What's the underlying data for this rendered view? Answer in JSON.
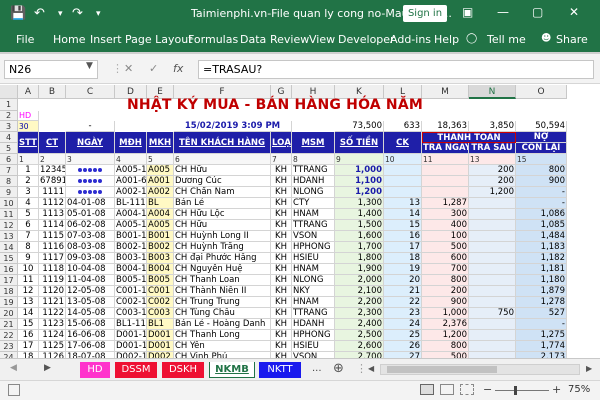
{
  "window": {
    "title": "Taimienphi.vn-File quan ly cong no-Mau01.xls...",
    "signin": "Sign in",
    "save_icon": "floppy-icon",
    "undo": "↶",
    "redo": "↷",
    "qat_more": "▾",
    "ribbon_opts": "▣",
    "minimize": "—",
    "restore": "▢",
    "close": "✕"
  },
  "menu": {
    "items": [
      "File",
      "Home",
      "Insert",
      "Page Layout",
      "Formulas",
      "Data",
      "Review",
      "View",
      "Developer",
      "Add-ins",
      "Help"
    ],
    "tellme": "Tell me",
    "share": "Share",
    "tellme_icon": "lightbulb-icon",
    "share_icon": "person-icon"
  },
  "formula": {
    "namebox": "N26",
    "cancel": "✕",
    "enter": "✓",
    "fx": "fx",
    "value": "=TRASAU?"
  },
  "columns": [
    "A",
    "B",
    "C",
    "D",
    "E",
    "F",
    "G",
    "H",
    "K",
    "L",
    "M",
    "N",
    "O"
  ],
  "row_numbers": [
    "1",
    "2",
    "3",
    "4",
    "5",
    "6",
    "7",
    "8",
    "9",
    "10",
    "11",
    "12",
    "13",
    "14",
    "15",
    "16",
    "17",
    "18",
    "19",
    "20",
    "21",
    "22",
    "23",
    "24"
  ],
  "sheet": {
    "title": "NHẬT KÝ MUA - BÁN HÀNG HÓA NĂM",
    "row2": {
      "a": "HD"
    },
    "row3": {
      "a": "30",
      "c": "-",
      "date": "15/02/2019 3:09 PM",
      "k": "73,500",
      "l": "633",
      "m": "18,363",
      "n": "3,850",
      "o": "50,594"
    },
    "headers": {
      "stt": "STT",
      "ct": "CT",
      "ngay": "NGÀY",
      "mdh": "MĐH",
      "mkh": "MKH",
      "ten": "TÊN KHÁCH HÀNG",
      "loai": "LOẠI",
      "msm": "MSM",
      "sotien": "SỐ TIỀN",
      "ck": "CK",
      "thanhtoan": "THANH TOÁN",
      "tra_ngay": "TRẢ NGAY",
      "tra_sau": "TRẢ SAU",
      "no1": "NỢ",
      "no2": "CÒN LẠI"
    },
    "numbering": [
      "1",
      "2",
      "3",
      "4",
      "5",
      "6",
      "7",
      "8",
      "9",
      "10",
      "11",
      "12",
      "13",
      "14",
      "15"
    ],
    "rows": [
      [
        "1",
        "12345",
        "dots",
        "A005-1234",
        "A005",
        "CH Hữu",
        "KH",
        "TTRANG",
        "1,000",
        "",
        "",
        "200",
        "800"
      ],
      [
        "2",
        "67891",
        "dots",
        "A001-6789",
        "A001",
        "Dương Cúc",
        "KH",
        "HDANH",
        "1,100",
        "",
        "",
        "200",
        "900"
      ],
      [
        "3",
        "1111",
        "dots",
        "A002-1111",
        "A002",
        "CH Chấn Nam",
        "KH",
        "NLONG",
        "1,200",
        "",
        "",
        "1,200",
        "-"
      ],
      [
        "4",
        "1112",
        "04-01-08",
        "BL-1112",
        "BL",
        "Bán Lẻ",
        "KH",
        "CTY",
        "1,300",
        "13",
        "1,287",
        "",
        "-"
      ],
      [
        "5",
        "1113",
        "05-01-08",
        "A004-1113",
        "A004",
        "CH Hữu Lộc",
        "KH",
        "HNAM",
        "1,400",
        "14",
        "300",
        "",
        "1,086"
      ],
      [
        "6",
        "1114",
        "06-02-08",
        "A005-1114",
        "A005",
        "CH Hữu",
        "KH",
        "TTRANG",
        "1,500",
        "15",
        "400",
        "",
        "1,085"
      ],
      [
        "7",
        "1115",
        "07-03-08",
        "B001-1115",
        "B001",
        "CH Huỳnh Long II",
        "KH",
        "VSON",
        "1,600",
        "16",
        "100",
        "",
        "1,484"
      ],
      [
        "8",
        "1116",
        "08-03-08",
        "B002-1116",
        "B002",
        "CH Huỳnh Trăng",
        "KH",
        "HPHONG",
        "1,700",
        "17",
        "500",
        "",
        "1,183"
      ],
      [
        "9",
        "1117",
        "09-03-08",
        "B003-1117",
        "B003",
        "CH đại Phước Hằng",
        "KH",
        "HSIEU",
        "1,800",
        "18",
        "600",
        "",
        "1,182"
      ],
      [
        "10",
        "1118",
        "10-04-08",
        "B004-1118",
        "B004",
        "CH Nguyễn Huệ",
        "KH",
        "HNAM",
        "1,900",
        "19",
        "700",
        "",
        "1,181"
      ],
      [
        "11",
        "1119",
        "11-04-08",
        "B005-1119",
        "B005",
        "CH Thanh Loan",
        "KH",
        "NLONG",
        "2,000",
        "20",
        "800",
        "",
        "1,180"
      ],
      [
        "12",
        "1120",
        "12-05-08",
        "C001-1120",
        "C001",
        "CH Thành Niên II",
        "KH",
        "NKY",
        "2,100",
        "21",
        "200",
        "",
        "1,879"
      ],
      [
        "13",
        "1121",
        "13-05-08",
        "C002-1121",
        "C002",
        "CH Trung Trung",
        "KH",
        "HNAM",
        "2,200",
        "22",
        "900",
        "",
        "1,278"
      ],
      [
        "14",
        "1122",
        "14-05-08",
        "C003-1122",
        "C003",
        "CH Tùng Châu",
        "KH",
        "TTRANG",
        "2,300",
        "23",
        "1,000",
        "750",
        "527"
      ],
      [
        "15",
        "1123",
        "15-06-08",
        "BL1-1123",
        "BL1",
        "Bán Lẻ - Hoàng Danh",
        "KH",
        "HDANH",
        "2,400",
        "24",
        "2,376",
        "",
        "-"
      ],
      [
        "16",
        "1124",
        "16-06-08",
        "D001-1124",
        "D001",
        "CH Thanh Long",
        "KH",
        "HPHONG",
        "2,500",
        "25",
        "1,200",
        "",
        "1,275"
      ],
      [
        "17",
        "1125",
        "17-06-08",
        "D001-1125",
        "D001",
        "CH Yên",
        "KH",
        "HSIEU",
        "2,600",
        "26",
        "800",
        "",
        "1,774"
      ],
      [
        "18",
        "1126",
        "18-07-08",
        "D002-1126",
        "D002",
        "CH Vinh Phú",
        "KH",
        "VSON",
        "2,700",
        "27",
        "500",
        "",
        "2,173"
      ]
    ]
  },
  "tabs": [
    {
      "label": "HD",
      "color": "#ff33cc"
    },
    {
      "label": "DSSM",
      "color": "#ee1133"
    },
    {
      "label": "DSKH",
      "color": "#ee1133"
    },
    {
      "label": "NKMB",
      "color": "#ffffff"
    },
    {
      "label": "NKTT",
      "color": "#1a1aee"
    }
  ],
  "tab_more": "...",
  "tab_add": "⊕",
  "nav_prev": "◀",
  "nav_next": "▶",
  "scroll_more": "⋮",
  "status": {
    "ready_icon": "sheet-status-icon",
    "zoom": "75%",
    "minus": "−",
    "plus": "+"
  }
}
